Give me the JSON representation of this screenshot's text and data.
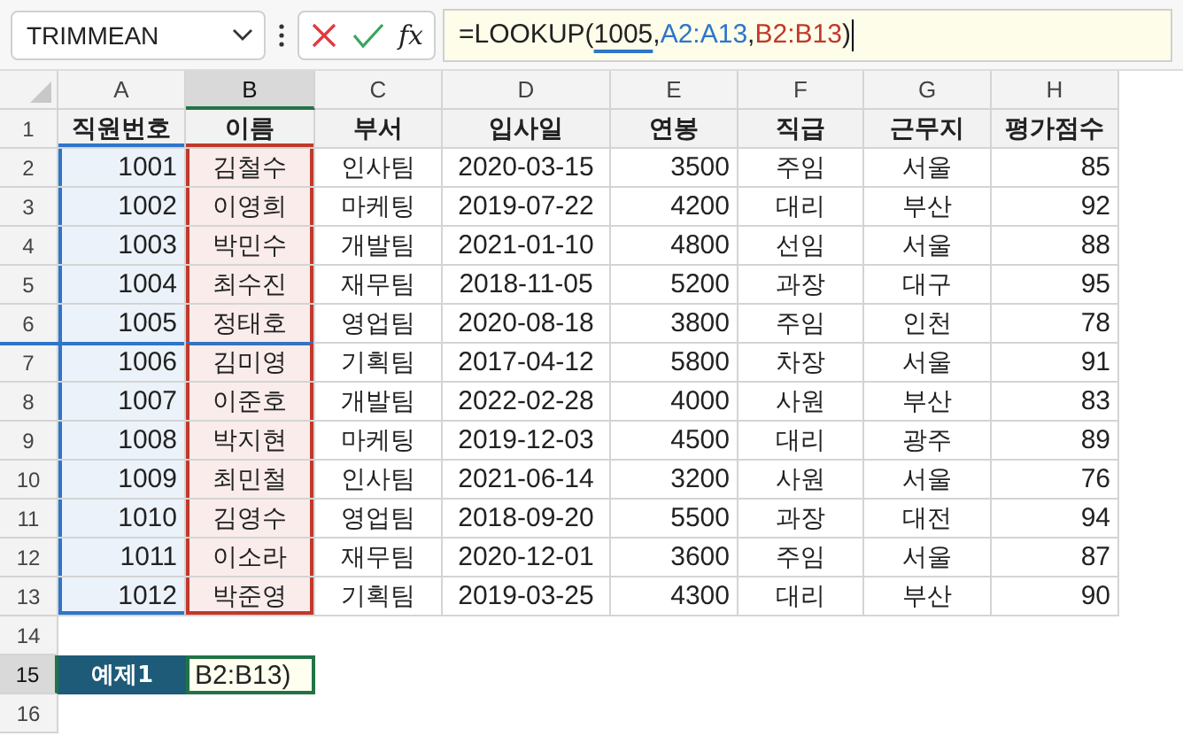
{
  "name_box": {
    "value": "TRIMMEAN"
  },
  "formula_bar": {
    "fx": "fx",
    "parts": [
      {
        "text": "=LOOKUP("
      },
      {
        "text": "1005",
        "underlined": true
      },
      {
        "text": ","
      },
      {
        "text": "A2:A13",
        "color": "#2f75c8"
      },
      {
        "text": ","
      },
      {
        "text": "B2:B13",
        "color": "#c0392b"
      },
      {
        "text": ")"
      }
    ]
  },
  "columns": [
    {
      "letter": "A",
      "selected": false,
      "kind": "number",
      "color": "#2f75c8"
    },
    {
      "letter": "B",
      "selected": true,
      "kind": "text",
      "color": "#c0392b"
    },
    {
      "letter": "C",
      "selected": false,
      "kind": "text"
    },
    {
      "letter": "D",
      "selected": false,
      "kind": "text"
    },
    {
      "letter": "E",
      "selected": false,
      "kind": "number"
    },
    {
      "letter": "F",
      "selected": false,
      "kind": "text"
    },
    {
      "letter": "G",
      "selected": false,
      "kind": "text"
    },
    {
      "letter": "H",
      "selected": false,
      "kind": "number"
    }
  ],
  "rows": [
    {
      "number": "1",
      "kind": "header",
      "selected": false,
      "cells": [
        "직원번호",
        "이름",
        "부서",
        "입사일",
        "연봉",
        "직급",
        "근무지",
        "평가점수"
      ]
    },
    {
      "number": "2",
      "kind": "data",
      "selected": false,
      "cells": [
        "1001",
        "김철수",
        "인사팀",
        "2020-03-15",
        "3500",
        "주임",
        "서울",
        "85"
      ]
    },
    {
      "number": "3",
      "kind": "data",
      "selected": false,
      "cells": [
        "1002",
        "이영희",
        "마케팅",
        "2019-07-22",
        "4200",
        "대리",
        "부산",
        "92"
      ]
    },
    {
      "number": "4",
      "kind": "data",
      "selected": false,
      "cells": [
        "1003",
        "박민수",
        "개발팀",
        "2021-01-10",
        "4800",
        "선임",
        "서울",
        "88"
      ]
    },
    {
      "number": "5",
      "kind": "data",
      "selected": false,
      "cells": [
        "1004",
        "최수진",
        "재무팀",
        "2018-11-05",
        "5200",
        "과장",
        "대구",
        "95"
      ]
    },
    {
      "number": "6",
      "kind": "data",
      "selected": false,
      "underlined": true,
      "cells": [
        "1005",
        "정태호",
        "영업팀",
        "2020-08-18",
        "3800",
        "주임",
        "인천",
        "78"
      ]
    },
    {
      "number": "7",
      "kind": "data",
      "selected": false,
      "cells": [
        "1006",
        "김미영",
        "기획팀",
        "2017-04-12",
        "5800",
        "차장",
        "서울",
        "91"
      ]
    },
    {
      "number": "8",
      "kind": "data",
      "selected": false,
      "cells": [
        "1007",
        "이준호",
        "개발팀",
        "2022-02-28",
        "4000",
        "사원",
        "부산",
        "83"
      ]
    },
    {
      "number": "9",
      "kind": "data",
      "selected": false,
      "cells": [
        "1008",
        "박지현",
        "마케팅",
        "2019-12-03",
        "4500",
        "대리",
        "광주",
        "89"
      ]
    },
    {
      "number": "10",
      "kind": "data",
      "selected": false,
      "cells": [
        "1009",
        "최민철",
        "인사팀",
        "2021-06-14",
        "3200",
        "사원",
        "서울",
        "76"
      ]
    },
    {
      "number": "11",
      "kind": "data",
      "selected": false,
      "cells": [
        "1010",
        "김영수",
        "영업팀",
        "2018-09-20",
        "5500",
        "과장",
        "대전",
        "94"
      ]
    },
    {
      "number": "12",
      "kind": "data",
      "selected": false,
      "cells": [
        "1011",
        "이소라",
        "재무팀",
        "2020-12-01",
        "3600",
        "주임",
        "서울",
        "87"
      ]
    },
    {
      "number": "13",
      "kind": "data",
      "selected": false,
      "cells": [
        "1012",
        "박준영",
        "기획팀",
        "2019-03-25",
        "4300",
        "대리",
        "부산",
        "90"
      ]
    },
    {
      "number": "14",
      "kind": "empty",
      "selected": false,
      "cells": []
    },
    {
      "number": "15",
      "kind": "example",
      "selected": true,
      "cells": [
        "예제1",
        "B2:B13)"
      ]
    },
    {
      "number": "16",
      "kind": "empty",
      "selected": false,
      "cells": []
    }
  ]
}
